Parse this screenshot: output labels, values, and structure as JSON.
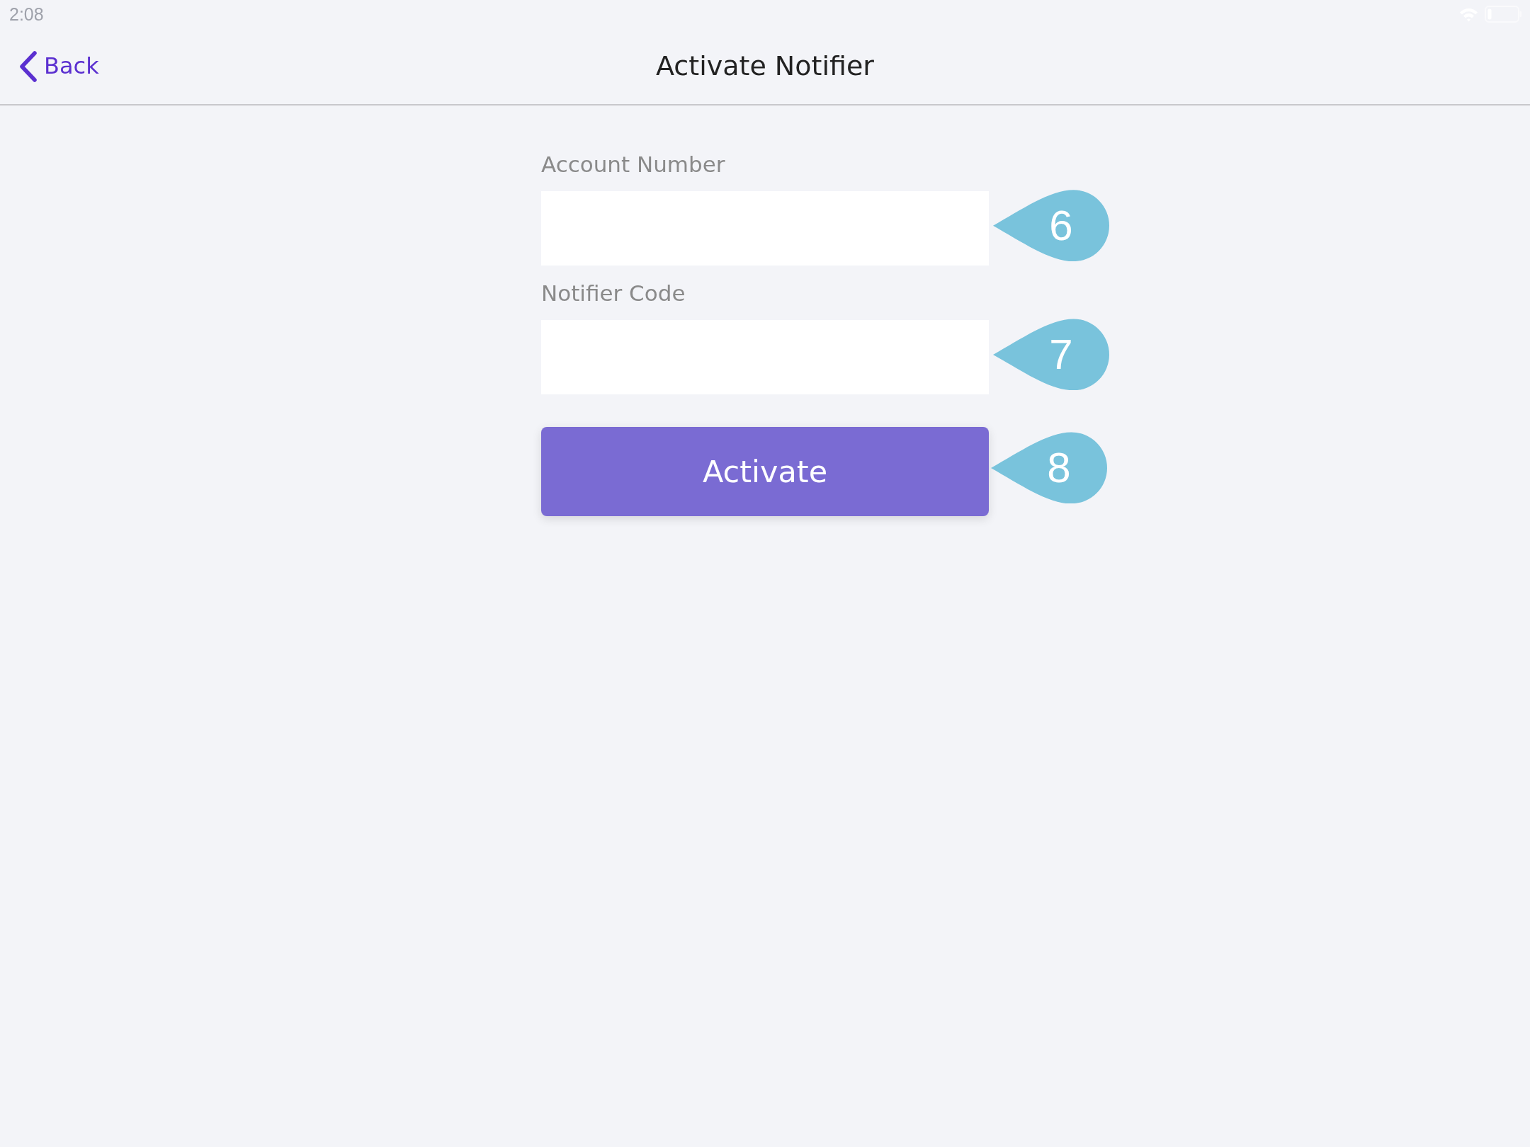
{
  "status_bar": {
    "time": "2:08"
  },
  "nav_bar": {
    "back_button": {
      "label": "Back"
    },
    "title": "Activate Notifier"
  },
  "form": {
    "fields": [
      {
        "label": "Account Number",
        "marker": "6"
      },
      {
        "label": "Notifier Code",
        "marker": "7"
      }
    ],
    "submit_button": {
      "label": "Activate",
      "marker": "8"
    }
  }
}
